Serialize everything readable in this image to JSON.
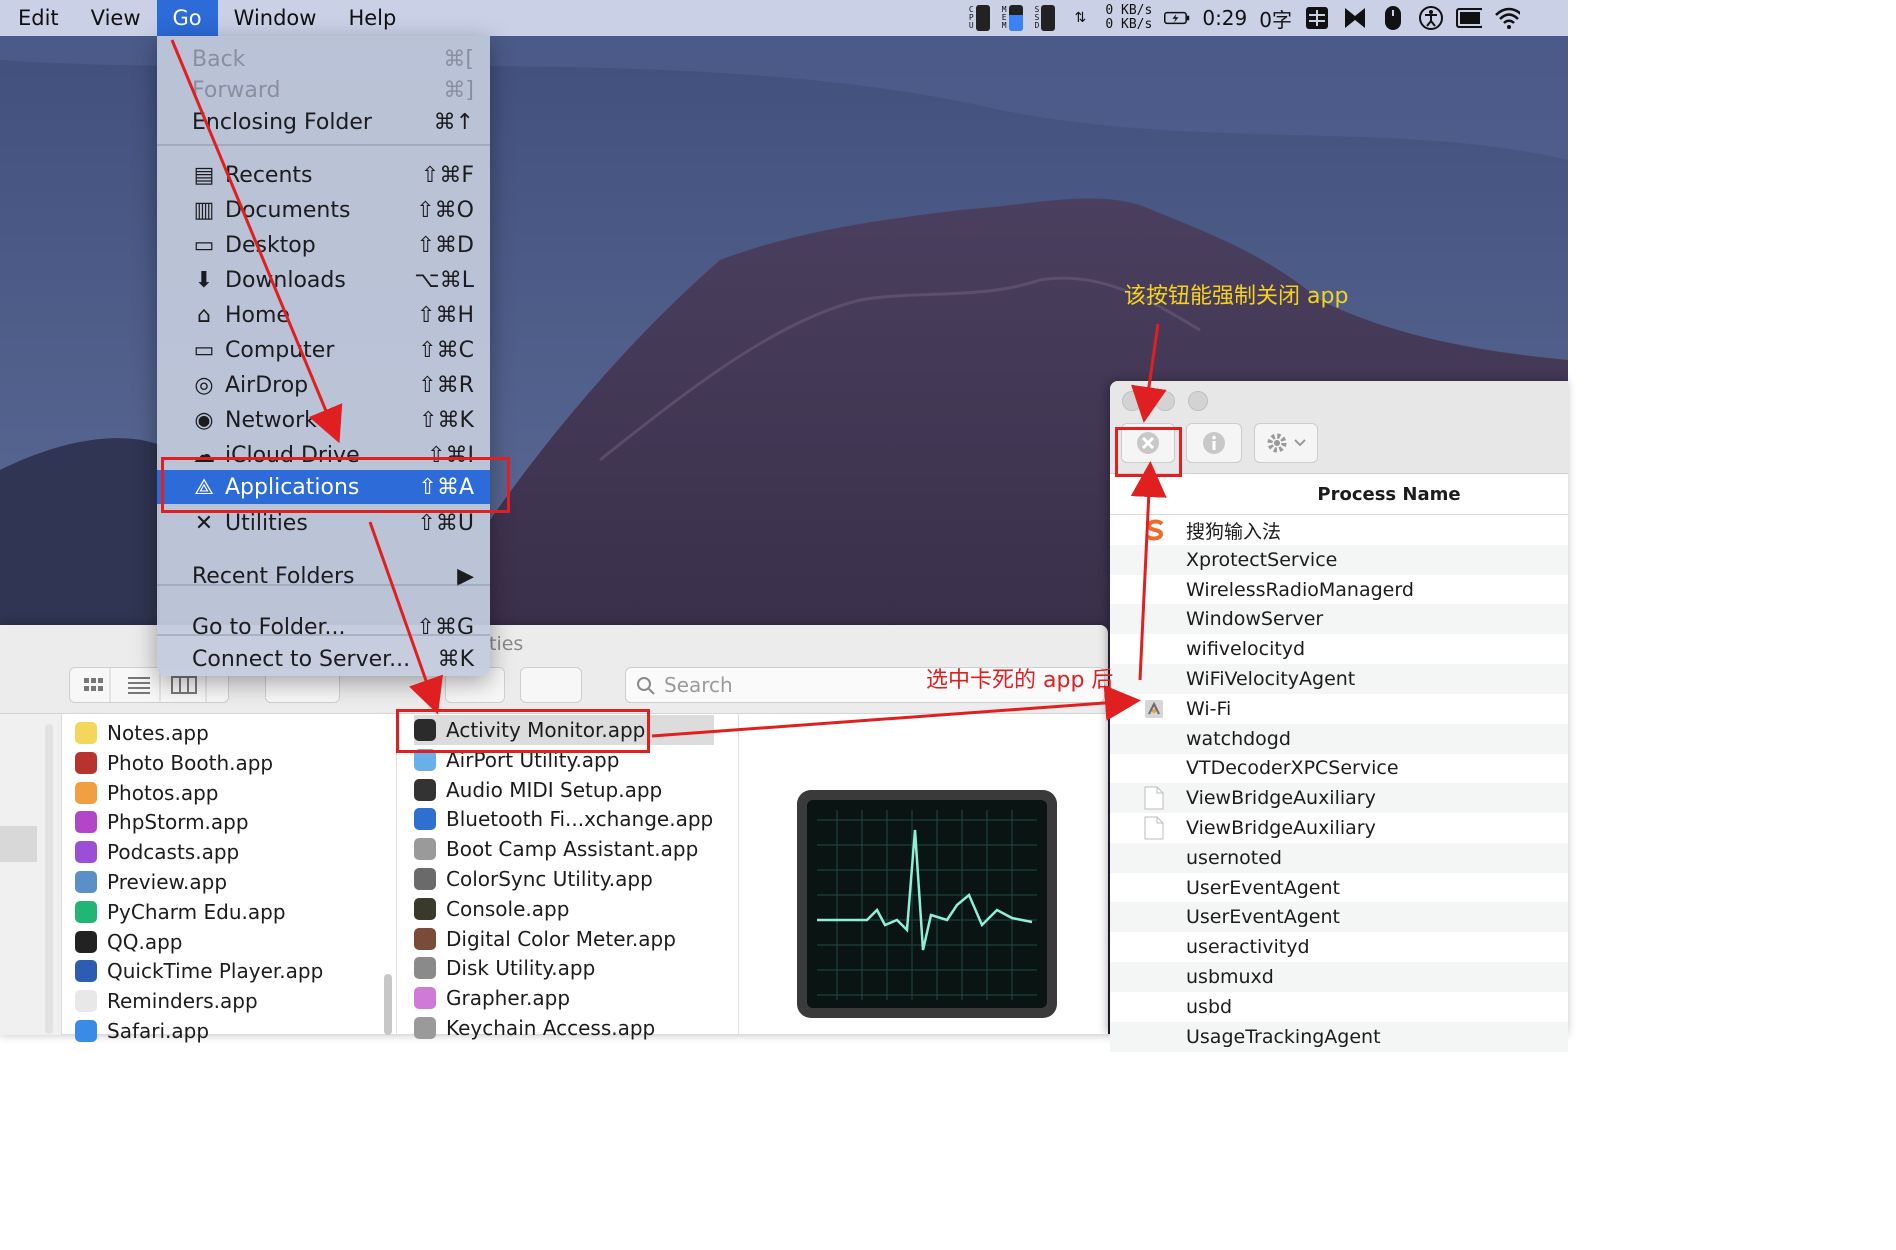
{
  "menubar": {
    "items": [
      "Edit",
      "View",
      "Go",
      "Window",
      "Help"
    ],
    "active": "Go",
    "status": {
      "meters": [
        {
          "label": "CPU",
          "letters": [
            "C",
            "P",
            "U"
          ]
        },
        {
          "label": "MEM",
          "letters": [
            "M",
            "E",
            "M"
          ]
        },
        {
          "label": "SSD",
          "letters": [
            "S",
            "S",
            "D"
          ]
        }
      ],
      "net_up": "0 KB/s",
      "net_down": "0 KB/s",
      "battery_time": "0:29",
      "ime_label": "0字",
      "icons": [
        "grid-input-icon",
        "bowtie-icon",
        "mouse-icon",
        "accessibility-icon",
        "display-icon",
        "wifi-icon"
      ]
    }
  },
  "go_menu": {
    "items": [
      {
        "label": "Back",
        "shortcut": "⌘[",
        "disabled": true,
        "icon": ""
      },
      {
        "label": "Forward",
        "shortcut": "⌘]",
        "disabled": true,
        "icon": ""
      },
      {
        "label": "Enclosing Folder",
        "shortcut": "⌘↑",
        "disabled": false,
        "icon": ""
      },
      {
        "label": "Recents",
        "shortcut": "⇧⌘F",
        "icon": "recents-icon"
      },
      {
        "label": "Documents",
        "shortcut": "⇧⌘O",
        "icon": "documents-icon"
      },
      {
        "label": "Desktop",
        "shortcut": "⇧⌘D",
        "icon": "desktop-icon"
      },
      {
        "label": "Downloads",
        "shortcut": "⌥⌘L",
        "icon": "downloads-icon"
      },
      {
        "label": "Home",
        "shortcut": "⇧⌘H",
        "icon": "home-icon"
      },
      {
        "label": "Computer",
        "shortcut": "⇧⌘C",
        "icon": "computer-icon"
      },
      {
        "label": "AirDrop",
        "shortcut": "⇧⌘R",
        "icon": "airdrop-icon"
      },
      {
        "label": "Network",
        "shortcut": "⇧⌘K",
        "icon": "network-icon"
      },
      {
        "label": "iCloud Drive",
        "shortcut": "⇧⌘I",
        "icon": "icloud-icon"
      },
      {
        "label": "Applications",
        "shortcut": "⇧⌘A",
        "icon": "applications-icon",
        "selected": true
      },
      {
        "label": "Utilities",
        "shortcut": "⇧⌘U",
        "icon": "utilities-icon"
      },
      {
        "label": "Recent Folders",
        "shortcut": "▶",
        "icon": ""
      },
      {
        "label": "Go to Folder...",
        "shortcut": "⇧⌘G",
        "icon": ""
      },
      {
        "label": "Connect to Server...",
        "shortcut": "⌘K",
        "icon": ""
      }
    ]
  },
  "finder": {
    "title_fragment": "ties",
    "search_placeholder": "Search",
    "applications": [
      {
        "name": "Notes.app",
        "color": "#f3d65a"
      },
      {
        "name": "Photo Booth.app",
        "color": "#b8322e"
      },
      {
        "name": "Photos.app",
        "color": "#f0a040"
      },
      {
        "name": "PhpStorm.app",
        "color": "#b345c8"
      },
      {
        "name": "Podcasts.app",
        "color": "#9a4fd6"
      },
      {
        "name": "Preview.app",
        "color": "#5a8fc8"
      },
      {
        "name": "PyCharm Edu.app",
        "color": "#22b573"
      },
      {
        "name": "QQ.app",
        "color": "#222222"
      },
      {
        "name": "QuickTime Player.app",
        "color": "#2c5db0"
      },
      {
        "name": "Reminders.app",
        "color": "#e8e8e8"
      },
      {
        "name": "Safari.app",
        "color": "#3a8be8"
      }
    ],
    "utilities": [
      {
        "name": "Activity Monitor.app",
        "color": "#2b2b2b"
      },
      {
        "name": "AirPort Utility.app",
        "color": "#6ab0e8"
      },
      {
        "name": "Audio MIDI Setup.app",
        "color": "#333333"
      },
      {
        "name": "Bluetooth Fi...xchange.app",
        "color": "#2f6fd0"
      },
      {
        "name": "Boot Camp Assistant.app",
        "color": "#9a9a9a"
      },
      {
        "name": "ColorSync Utility.app",
        "color": "#6a6a6a"
      },
      {
        "name": "Console.app",
        "color": "#3a3a2a"
      },
      {
        "name": "Digital Color Meter.app",
        "color": "#7a4a3a"
      },
      {
        "name": "Disk Utility.app",
        "color": "#8a8a8a"
      },
      {
        "name": "Grapher.app",
        "color": "#d07ad8"
      },
      {
        "name": "Keychain Access.app",
        "color": "#9a9a9a"
      }
    ]
  },
  "activity_monitor": {
    "column_header": "Process Name",
    "processes": [
      {
        "name": "搜狗输入法",
        "icon": "sogou-icon"
      },
      {
        "name": "XprotectService",
        "icon": ""
      },
      {
        "name": "WirelessRadioManagerd",
        "icon": ""
      },
      {
        "name": "WindowServer",
        "icon": ""
      },
      {
        "name": "wifivelocityd",
        "icon": ""
      },
      {
        "name": "WiFiVelocityAgent",
        "icon": ""
      },
      {
        "name": "Wi-Fi",
        "icon": "wifi-app-icon"
      },
      {
        "name": "watchdogd",
        "icon": ""
      },
      {
        "name": "VTDecoderXPCService",
        "icon": ""
      },
      {
        "name": "ViewBridgeAuxiliary",
        "icon": "document-icon"
      },
      {
        "name": "ViewBridgeAuxiliary",
        "icon": "document-icon"
      },
      {
        "name": "usernoted",
        "icon": ""
      },
      {
        "name": "UserEventAgent",
        "icon": ""
      },
      {
        "name": "UserEventAgent",
        "icon": ""
      },
      {
        "name": "useractivityd",
        "icon": ""
      },
      {
        "name": "usbmuxd",
        "icon": ""
      },
      {
        "name": "usbd",
        "icon": ""
      },
      {
        "name": "UsageTrackingAgent",
        "icon": ""
      }
    ]
  },
  "annotations": {
    "force_quit_note": "该按钮能强制关闭 app",
    "select_note": "选中卡死的 app 后"
  },
  "colors": {
    "menubar": "#cad1e7",
    "selection": "#2c6bd8",
    "annotation_red": "#e02020",
    "annotation_yellow": "#f5d31e"
  }
}
